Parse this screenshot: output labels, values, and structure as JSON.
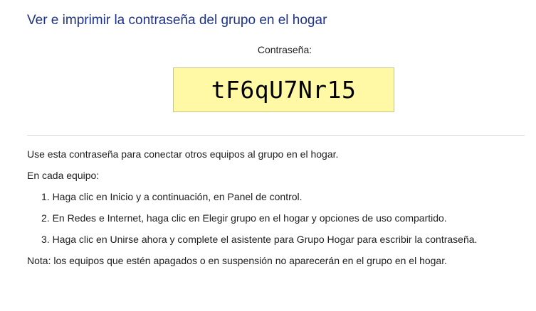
{
  "header": {
    "title": "Ver e imprimir la contraseña del grupo en el hogar"
  },
  "password": {
    "label": "Contraseña:",
    "value": "tF6qU7Nr15"
  },
  "instructions": {
    "intro": "Use esta contraseña para conectar otros equipos al grupo en el hogar.",
    "each_pc": "En cada equipo:",
    "steps": [
      "1. Haga clic en Inicio y a continuación, en Panel de control.",
      "2. En Redes e Internet, haga clic en Elegir grupo en el hogar y opciones de uso compartido.",
      "3. Haga clic en Unirse ahora y complete el asistente para Grupo Hogar para escribir la contraseña."
    ],
    "note": "Nota: los equipos que estén apagados o en suspensión no aparecerán en el grupo en el hogar."
  },
  "colors": {
    "title": "#1e3287",
    "password_background": "#fff9a6"
  }
}
